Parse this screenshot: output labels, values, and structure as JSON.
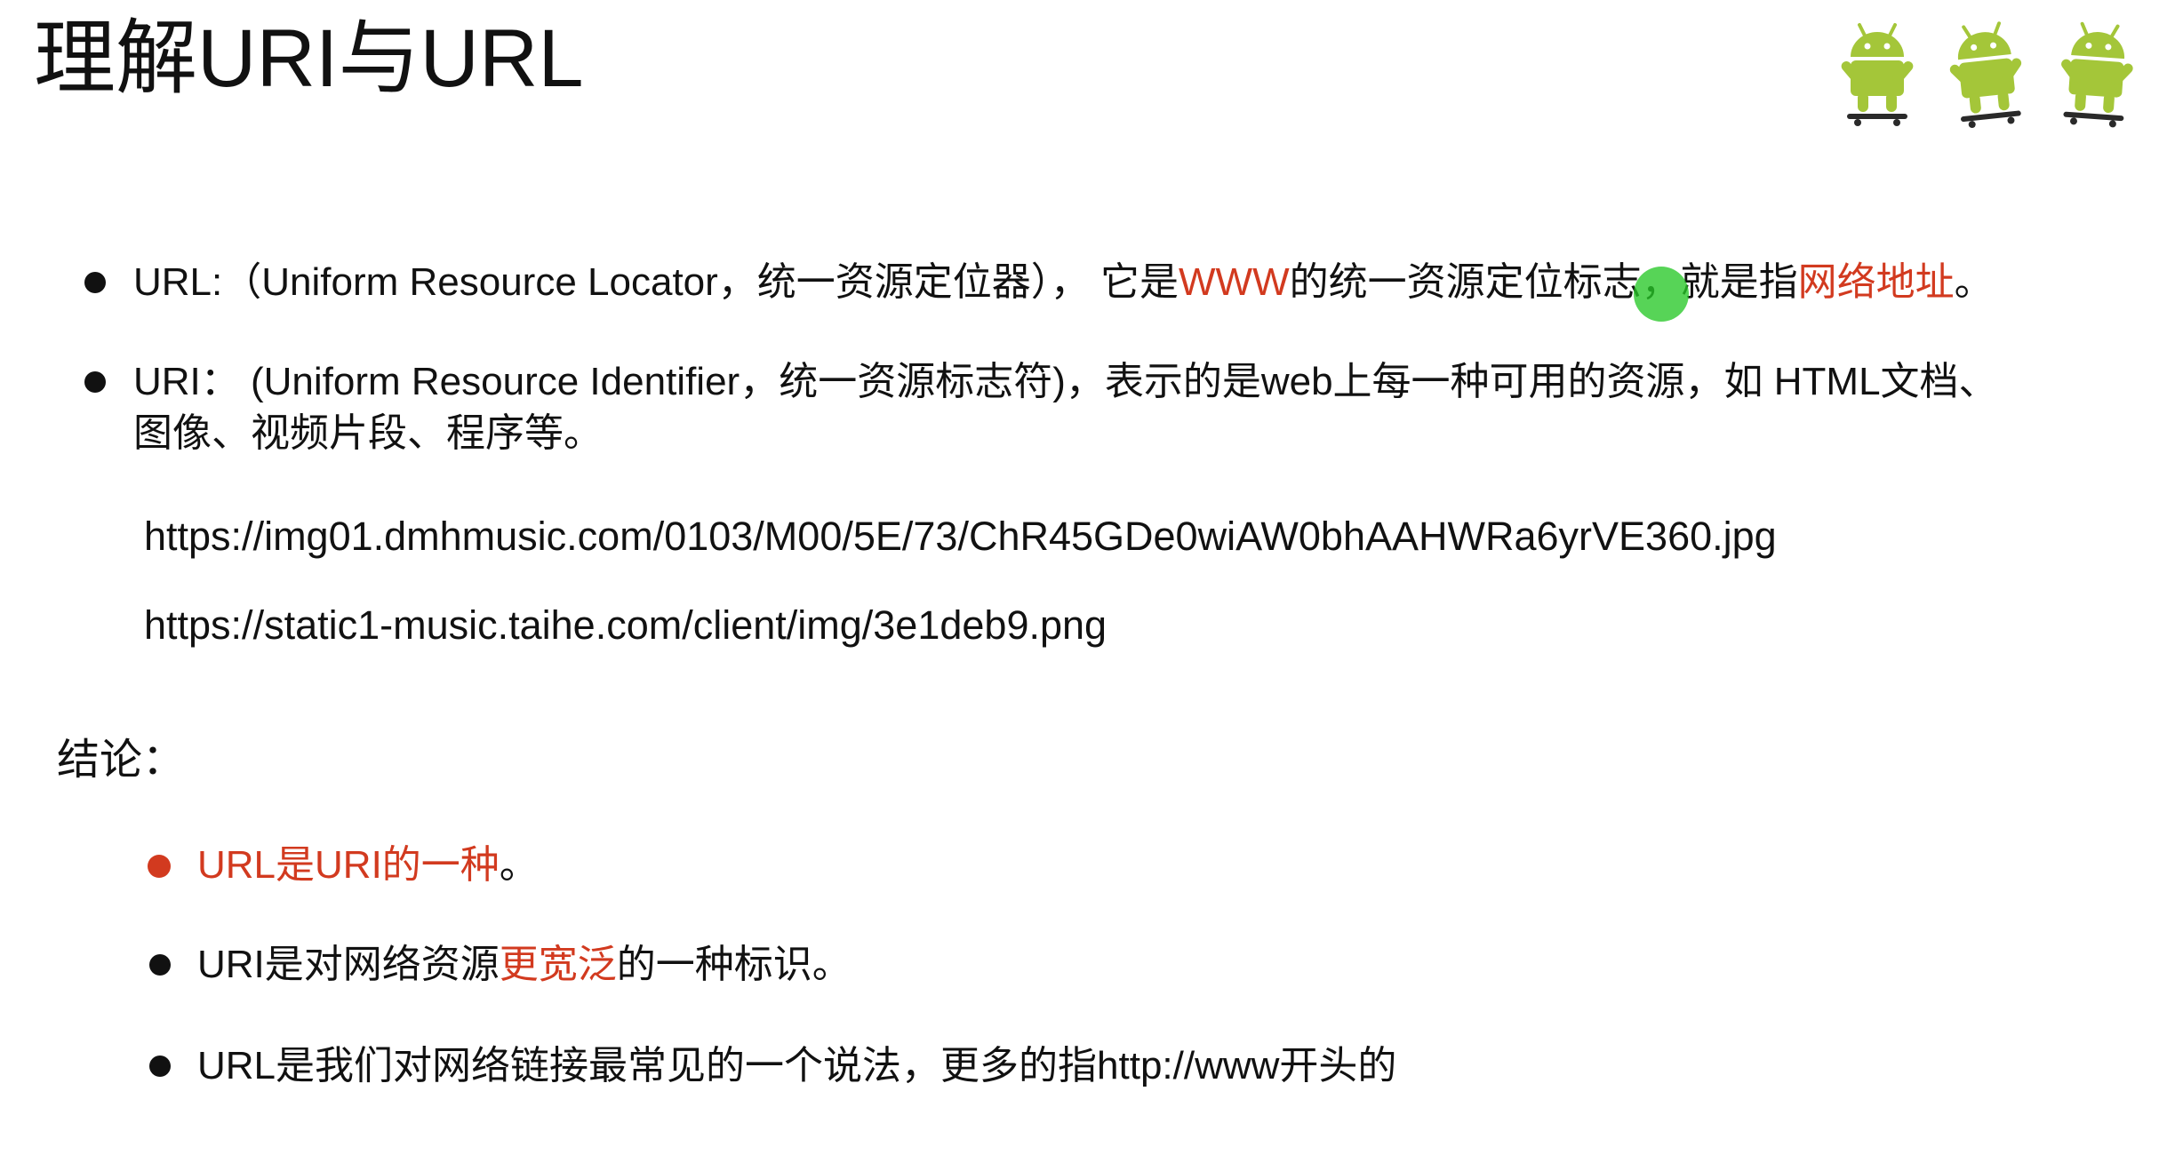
{
  "title": "理解URI与URL",
  "uri_url_points": [
    {
      "a": "URL:（Uniform Resource Locator，统一资源定位器），  它是",
      "b": "WWW",
      "c": "的统一资源定位标志，就是指",
      "d": "网络地址",
      "e": "。"
    },
    {
      "line1": "URI： (Uniform Resource Identifier，统一资源标志符)，表示的是web上每一种可用的资源，如 HTML文档、",
      "line2": "图像、视频片段、程序等。"
    }
  ],
  "example_urls": [
    "https://img01.dmhmusic.com/0103/M00/5E/73/ChR45GDe0wiAW0bhAAHWRa6yrVE360.jpg",
    "https://static1-music.taihe.com/client/img/3e1deb9.png"
  ],
  "conclusion_label": "结论：",
  "conclusions": [
    {
      "text": "URL是URI的一种",
      "suffix": "。"
    },
    {
      "a": "URI是对网络资源",
      "b": "更宽泛",
      "c": "的一种标识。"
    },
    {
      "text": "URL是我们对网络链接最常见的一个说法，更多的指http://www开头的"
    }
  ],
  "logo": {
    "icon": "android-robots-skateboarding",
    "color": "#a4c639"
  },
  "colors": {
    "accent_red": "#d23a1f",
    "text": "#111111",
    "cursor": "#28c828"
  }
}
